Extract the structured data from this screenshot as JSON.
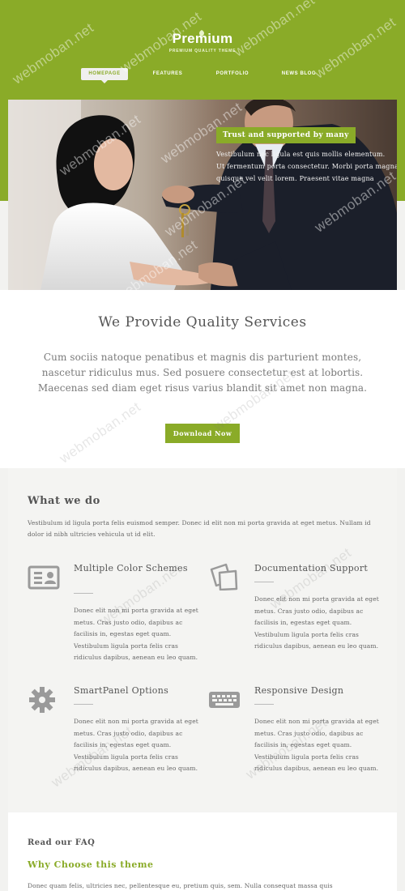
{
  "brand": {
    "title": "Premium",
    "tagline": "PREMIUM QUALITY THEME"
  },
  "nav": [
    {
      "label": "HOMEPAGE",
      "active": true
    },
    {
      "label": "FEATURES",
      "active": false
    },
    {
      "label": "PORTFOLIO",
      "active": false
    },
    {
      "label": "NEWS BLOG",
      "active": false
    }
  ],
  "hero": {
    "banner": "Trust and supported by many",
    "lines": [
      "Vestibulum nec ligula est quis mollis elementum.",
      "Ut fermentum porta consectetur. Morbi porta magna",
      "quisque vel velit lorem. Praesent vitae magna"
    ]
  },
  "services": {
    "heading": "We Provide Quality Services",
    "text": "Cum sociis natoque penatibus et magnis dis parturient montes, nascetur ridiculus mus. Sed posuere consectetur est at lobortis. Maecenas sed diam eget risus varius blandit sit amet non magna.",
    "button": "Download Now"
  },
  "whatwedo": {
    "heading": "What we do",
    "intro": "Vestibulum id ligula porta felis euismod semper. Donec id elit non mi porta gravida at eget metus. Nullam id dolor id nibh ultricies vehicula ut id elit.",
    "features": [
      {
        "title": "Multiple Color Schemes",
        "icon": "id-card-icon",
        "text": "Donec elit non mi porta gravida at eget metus. Cras justo odio, dapibus ac facilisis in, egestas eget quam. Vestibulum ligula porta felis cras ridiculus dapibus, aenean eu leo quam."
      },
      {
        "title": "Documentation Support",
        "icon": "documents-icon",
        "text": "Donec elit non mi porta gravida at eget metus. Cras justo odio, dapibus ac facilisis in, egestas eget quam. Vestibulum ligula porta felis cras ridiculus dapibus, aenean eu leo quam."
      },
      {
        "title": "SmartPanel Options",
        "icon": "gear-icon",
        "text": "Donec elit non mi porta gravida at eget metus. Cras justo odio, dapibus ac facilisis in, egestas eget quam. Vestibulum ligula porta felis cras ridiculus dapibus, aenean eu leo quam."
      },
      {
        "title": "Responsive Design",
        "icon": "keyboard-icon",
        "text": "Donec elit non mi porta gravida at eget metus. Cras justo odio, dapibus ac facilisis in, egestas eget quam. Vestibulum ligula porta felis cras ridiculus dapibus, aenean eu leo quam."
      }
    ]
  },
  "faq": {
    "heading": "Read our FAQ",
    "subheading": "Why Choose this theme",
    "text": "Donec quam felis, ultricies nec, pellentesque eu, pretium quis, sem. Nulla consequat massa quis"
  },
  "watermark": "webmoban.net",
  "colors": {
    "accent": "#8aab28",
    "page_bg": "#f2f2f0",
    "text": "#555555"
  }
}
